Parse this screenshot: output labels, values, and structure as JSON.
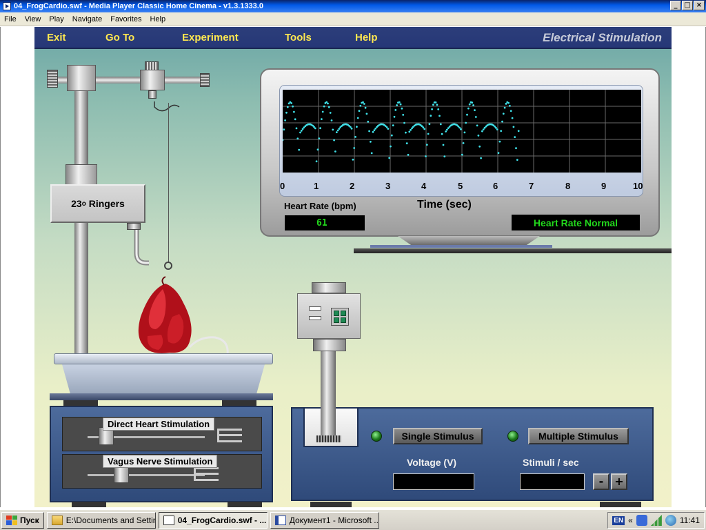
{
  "window": {
    "title": "04_FrogCardio.swf - Media Player Classic Home Cinema - v1.3.1333.0",
    "controls": {
      "minimize": "_",
      "maximize": "□",
      "close": "×"
    }
  },
  "menubar": [
    "File",
    "View",
    "Play",
    "Navigate",
    "Favorites",
    "Help"
  ],
  "app_menu": {
    "items": [
      "Exit",
      "Go To",
      "Experiment",
      "Tools",
      "Help"
    ],
    "title": "Electrical Stimulation"
  },
  "ringers": {
    "label": "23",
    "sup": "o",
    "suffix": " Ringers"
  },
  "monitor": {
    "x_ticks": [
      "0",
      "1",
      "2",
      "3",
      "4",
      "5",
      "6",
      "7",
      "8",
      "9",
      "10"
    ],
    "x_label": "Time (sec)",
    "heart_rate_label": "Heart Rate (bpm)",
    "heart_rate_value": "61",
    "status": "Heart Rate Normal",
    "trace_color": "#3fe0e8",
    "trace_end_sec": 6.6
  },
  "left_panel": {
    "direct": "Direct Heart Stimulation",
    "vagus": "Vagus Nerve Stimulation"
  },
  "right_panel": {
    "single_stimulus": "Single Stimulus",
    "multiple_stimulus": "Multiple Stimulus",
    "voltage_label": "Voltage (V)",
    "stimuli_label": "Stimuli / sec",
    "minus": "-",
    "plus": "+"
  },
  "taskbar": {
    "start": "Пуск",
    "tasks": [
      "E:\\Documents and Settin...",
      "04_FrogCardio.swf - ...",
      "Документ1 - Microsoft ..."
    ],
    "active_task": 1,
    "lang": "EN",
    "chevron": "«",
    "clock": "11:41"
  }
}
